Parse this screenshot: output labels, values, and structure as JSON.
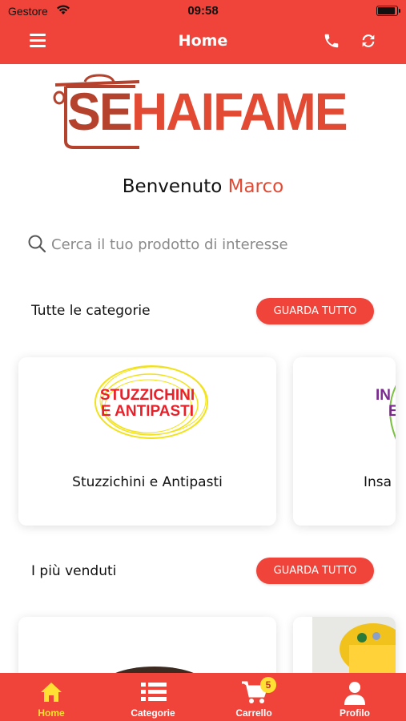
{
  "status_bar": {
    "carrier": "Gestore",
    "time": "09:58"
  },
  "header": {
    "title": "Home"
  },
  "logo": {
    "text_se": "SE",
    "text_rest": "HAIFAME"
  },
  "welcome": {
    "greeting": "Benvenuto",
    "user_name": "Marco"
  },
  "search": {
    "placeholder": "Cerca il tuo prodotto di interesse",
    "value": ""
  },
  "sections": {
    "categories": {
      "title": "Tutte le categorie",
      "button_label": "GUARDA TUTTO"
    },
    "best_sellers": {
      "title": "I più venduti",
      "button_label": "GUARDA TUTTO"
    }
  },
  "categories": [
    {
      "name": "Stuzzichini e Antipasti",
      "image_text_line1": "STUZZICHINI",
      "image_text_line2": "E ANTIPASTI"
    },
    {
      "name": "Insa",
      "image_text_line1": "IN",
      "image_text_line2": "E"
    }
  ],
  "bottom_nav": {
    "items": [
      {
        "label": "Home",
        "icon": "home-icon",
        "active": true
      },
      {
        "label": "Categorie",
        "icon": "list-icon",
        "active": false
      },
      {
        "label": "Carrello",
        "icon": "cart-icon",
        "active": false
      },
      {
        "label": "Profilo",
        "icon": "user-icon",
        "active": false
      }
    ],
    "cart_count": "5"
  },
  "colors": {
    "brand": "#f0443a",
    "accent_active": "#ffe033",
    "logo_dark": "#b5422d"
  }
}
